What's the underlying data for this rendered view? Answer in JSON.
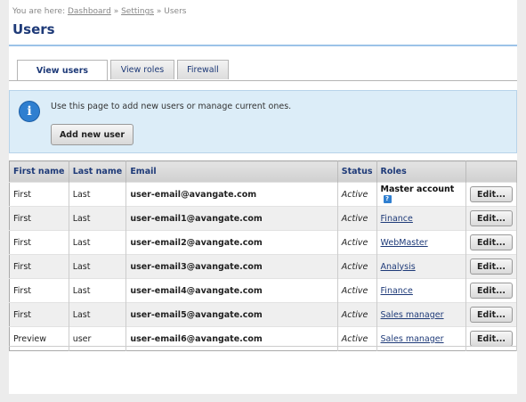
{
  "breadcrumb": {
    "prefix": "You are here:",
    "items": [
      "Dashboard",
      "Settings",
      "Users"
    ],
    "separator": "»"
  },
  "page": {
    "title": "Users"
  },
  "tabs": [
    {
      "label": "View users",
      "active": true
    },
    {
      "label": "View roles",
      "active": false
    },
    {
      "label": "Firewall",
      "active": false
    }
  ],
  "info": {
    "icon": "info-icon",
    "text": "Use this page to add new users or manage current ones.",
    "add_button": "Add new user"
  },
  "table": {
    "headers": [
      "First name",
      "Last name",
      "Email",
      "Status",
      "Roles",
      ""
    ],
    "edit_label": "Edit...",
    "rows": [
      {
        "first": "First",
        "last": "Last",
        "email": "user-email@avangate.com",
        "status": "Active",
        "role": "Master account",
        "master": true
      },
      {
        "first": "First",
        "last": "Last",
        "email": "user-email1@avangate.com",
        "status": "Active",
        "role": "Finance",
        "master": false
      },
      {
        "first": "First",
        "last": "Last",
        "email": "user-email2@avangate.com",
        "status": "Active",
        "role": "WebMaster",
        "master": false
      },
      {
        "first": "First",
        "last": "Last",
        "email": "user-email3@avangate.com",
        "status": "Active",
        "role": "Analysis",
        "master": false
      },
      {
        "first": "First",
        "last": "Last",
        "email": "user-email4@avangate.com",
        "status": "Active",
        "role": "Finance",
        "master": false
      },
      {
        "first": "First",
        "last": "Last",
        "email": "user-email5@avangate.com",
        "status": "Active",
        "role": "Sales manager",
        "master": false
      },
      {
        "first": "Preview",
        "last": "user",
        "email": "user-email6@avangate.com",
        "status": "Active",
        "role": "Sales manager",
        "master": false
      }
    ]
  },
  "colors": {
    "accent": "#1e3a78",
    "info_bg": "#dcedf8",
    "info_icon": "#2f7fd0"
  }
}
